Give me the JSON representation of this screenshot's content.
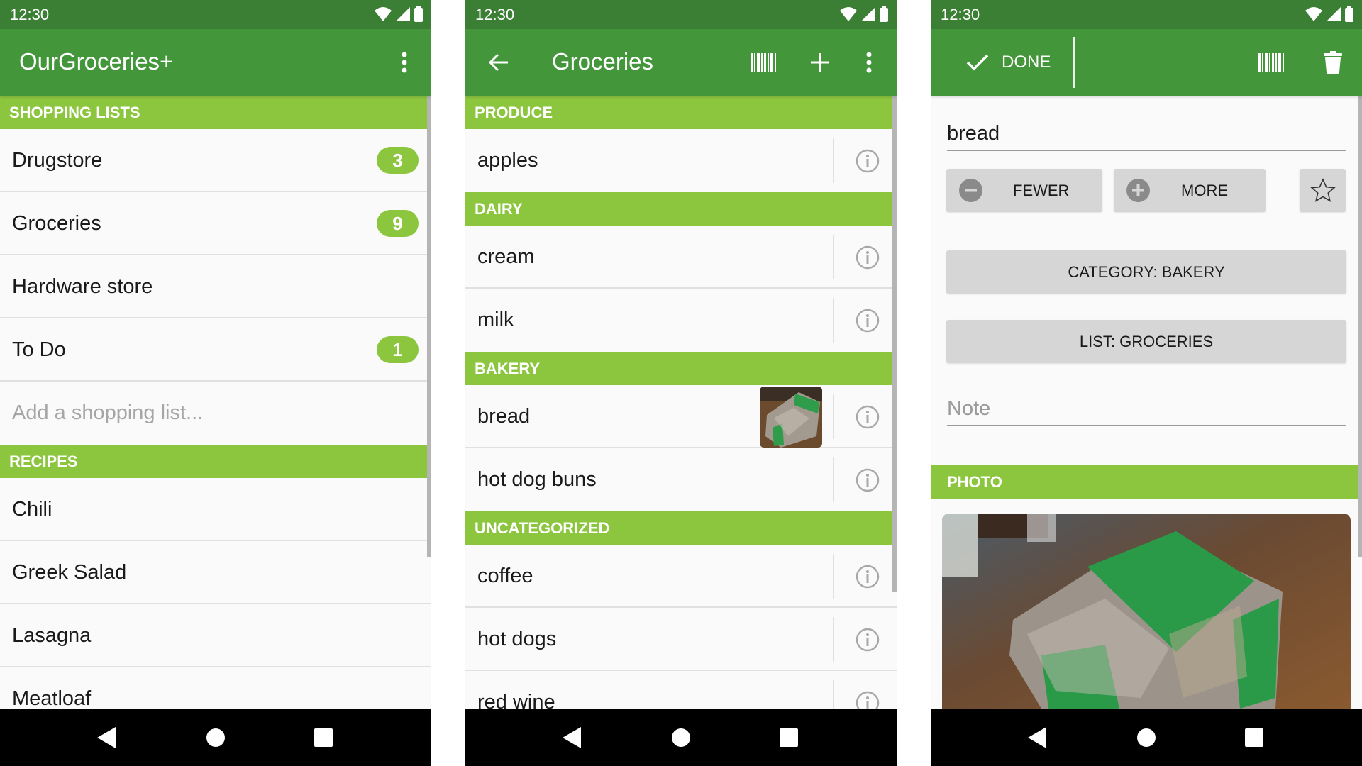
{
  "colors": {
    "status_bar": "#3a7f33",
    "app_bar": "#43963a",
    "section_header": "#8cc63f",
    "badge": "#8cc63f",
    "nav_bar": "#000000",
    "background": "#fafafa"
  },
  "status_bar": {
    "time": "12:30",
    "icons": [
      "wifi-icon",
      "cellular-signal-icon",
      "battery-icon"
    ]
  },
  "nav_bar": {
    "buttons": [
      "back-triangle-icon",
      "home-circle-icon",
      "recents-square-icon"
    ]
  },
  "screen1": {
    "title": "OurGroceries+",
    "menu_icon": "overflow-menu-icon",
    "sections": [
      {
        "header": "SHOPPING LISTS",
        "items": [
          {
            "label": "Drugstore",
            "count": "3"
          },
          {
            "label": "Groceries",
            "count": "9"
          },
          {
            "label": "Hardware store",
            "count": null
          },
          {
            "label": "To Do",
            "count": "1"
          }
        ],
        "add_placeholder": "Add a shopping list..."
      },
      {
        "header": "RECIPES",
        "items": [
          {
            "label": "Chili"
          },
          {
            "label": "Greek Salad"
          },
          {
            "label": "Lasagna"
          },
          {
            "label": "Meatloaf"
          }
        ]
      }
    ]
  },
  "screen2": {
    "title": "Groceries",
    "icons": [
      "back-arrow-icon",
      "barcode-icon",
      "add-icon",
      "overflow-menu-icon"
    ],
    "sections": [
      {
        "header": "PRODUCE",
        "items": [
          {
            "label": "apples"
          }
        ]
      },
      {
        "header": "DAIRY",
        "items": [
          {
            "label": "cream"
          },
          {
            "label": "milk"
          }
        ]
      },
      {
        "header": "BAKERY",
        "items": [
          {
            "label": "bread",
            "has_photo": true
          },
          {
            "label": "hot dog buns"
          }
        ]
      },
      {
        "header": "UNCATEGORIZED",
        "items": [
          {
            "label": "coffee"
          },
          {
            "label": "hot dogs"
          },
          {
            "label": "red wine"
          }
        ]
      }
    ]
  },
  "screen3": {
    "done_label": "DONE",
    "icons": [
      "checkmark-icon",
      "barcode-icon",
      "delete-icon"
    ],
    "item_name": "bread",
    "fewer_label": "FEWER",
    "more_label": "MORE",
    "favorite_icon": "star-outline-icon",
    "category_button": "CATEGORY: BAKERY",
    "list_button": "LIST: GROCERIES",
    "note_placeholder": "Note",
    "photo_header": "PHOTO"
  }
}
